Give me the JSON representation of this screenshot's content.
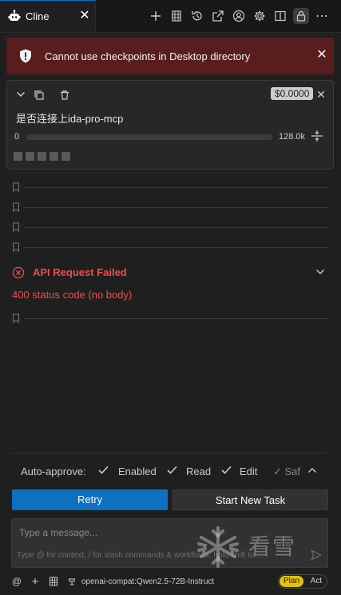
{
  "tab": {
    "title": "Cline",
    "close": "✕"
  },
  "toolbar": {
    "icons": [
      "plus-icon",
      "database-icon",
      "history-icon",
      "external-link-icon",
      "account-icon",
      "gear-icon",
      "split-view-icon",
      "lock-icon",
      "more-icon"
    ],
    "more": "⋯"
  },
  "error_banner": {
    "text": "Cannot use checkpoints in Desktop directory",
    "close": "✕"
  },
  "task": {
    "cost": "$0.0000",
    "close": "✕",
    "title": "是否连接上ida-pro-mcp",
    "context_min": "0",
    "context_max": "128.0k",
    "context_used_fraction": 0
  },
  "api_error": {
    "title": "API Request Failed",
    "detail": "400 status code (no body)"
  },
  "auto_approve": {
    "label": "Auto-approve:",
    "options": [
      {
        "label": "Enabled",
        "checked": true
      },
      {
        "label": "Read",
        "checked": true
      },
      {
        "label": "Edit",
        "checked": true
      }
    ],
    "overflow": "✓ Saf"
  },
  "buttons": {
    "retry": "Retry",
    "new_task": "Start New Task"
  },
  "input": {
    "placeholder": "Type a message...",
    "hint": "Type @ for context, / for slash commands & workflows, hold shift to ..."
  },
  "watermark": {
    "text": "看雪"
  },
  "bottom": {
    "at": "@",
    "plus": "+",
    "model": "openai-compat:Qwen2.5-72B-Instruct",
    "mode_plan": "Plan",
    "mode_act": "Act",
    "active_mode": "Plan"
  },
  "colors": {
    "accent": "#0e70c0",
    "error": "#f14c4c",
    "error_bg": "#5a1d1d",
    "plan": "#e6c300"
  }
}
